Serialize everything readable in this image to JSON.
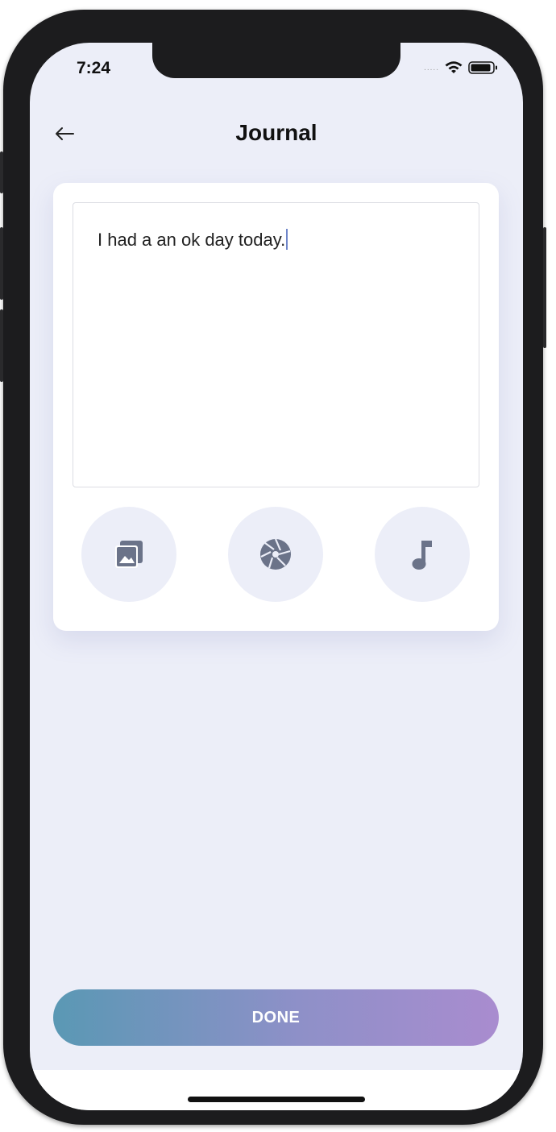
{
  "status_bar": {
    "time": "7:24",
    "signal_dots": "....."
  },
  "header": {
    "title": "Journal"
  },
  "journal": {
    "entry_text": "I had a an ok day today."
  },
  "tools": [
    {
      "icon": "gallery-icon"
    },
    {
      "icon": "camera-aperture-icon"
    },
    {
      "icon": "music-note-icon"
    }
  ],
  "actions": {
    "done_label": "DONE"
  },
  "colors": {
    "background": "#eceef8",
    "icon": "#6b7389",
    "gradient_start": "#5a98b4",
    "gradient_end": "#a98ccf"
  }
}
